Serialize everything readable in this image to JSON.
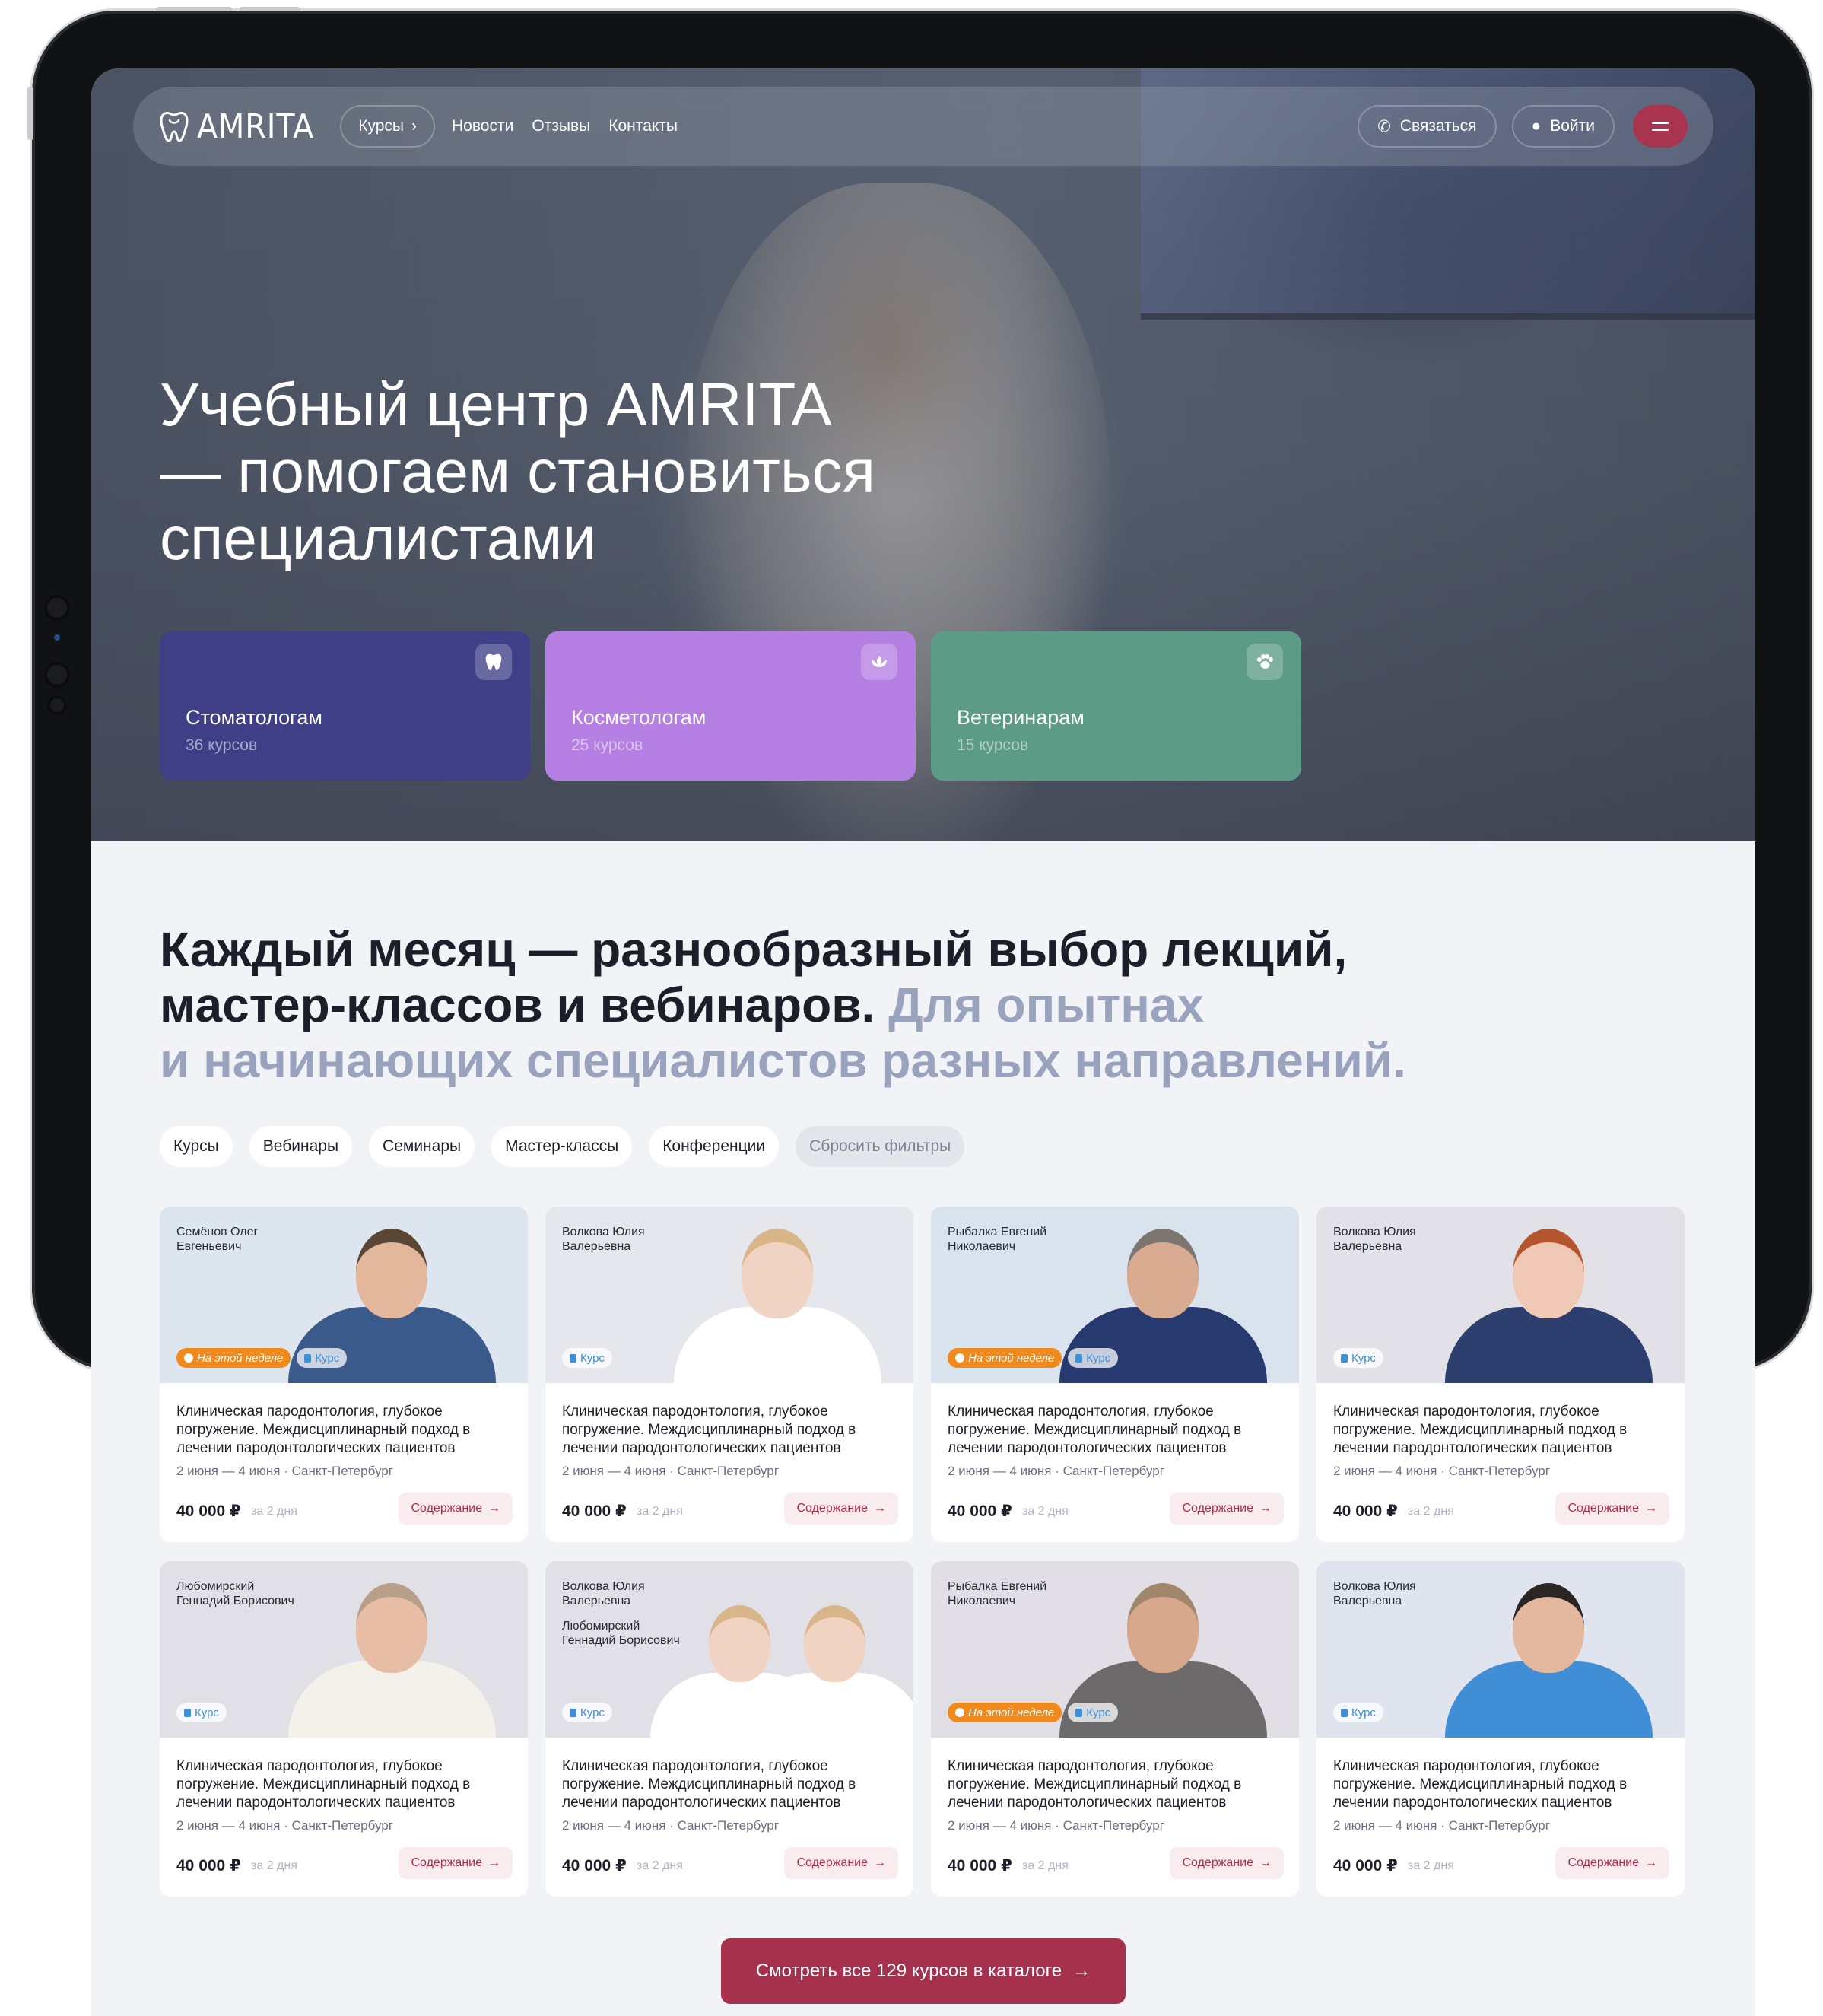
{
  "nav": {
    "logo": "AMRITA",
    "courses": "Курсы",
    "links": [
      "Новости",
      "Отзывы",
      "Контакты"
    ],
    "contact": "Связаться",
    "login": "Войти"
  },
  "hero": {
    "title_line1": "Учебный центр AMRITA",
    "title_line2": "— помогаем становиться",
    "title_line3": "специалистами",
    "categories": [
      {
        "name": "Стоматологам",
        "count": "36 курсов",
        "color": "#3e3f86",
        "icon": "tooth-icon"
      },
      {
        "name": "Косметологам",
        "count": "25 курсов",
        "color": "#b57fe3",
        "icon": "lotus-icon"
      },
      {
        "name": "Ветеринарам",
        "count": "15 курсов",
        "color": "#5c9b86",
        "icon": "paw-icon"
      }
    ]
  },
  "section": {
    "title_dark1": "Каждый месяц — разнообразный выбор лекций,",
    "title_dark2": "мастер-классов и вебинаров.",
    "title_muted1": "Для опытнах",
    "title_muted2": "и начинающих специалистов разных направлений.",
    "filters": [
      "Курсы",
      "Вебинары",
      "Семинары",
      "Мастер-классы",
      "Конференции"
    ],
    "reset": "Сбросить фильтры"
  },
  "course_common": {
    "title": "Клиническая пародонтология, глубокое погружение. Междисциплинарный подход в лечении пародонтологических пациентов",
    "meta": "2 июня — 4 июня · Санкт-Петербург",
    "price": "40 000 ₽",
    "duration": "за 2 дня",
    "more": "Содержание",
    "week_badge": "На этой неделе",
    "kind_badge": "Курс"
  },
  "courses": [
    {
      "author": "Семёнов Олег\nЕвгеньевич",
      "week": true
    },
    {
      "author": "Волкова Юлия\nВалерьевна",
      "week": false
    },
    {
      "author": "Рыбалка Евгений\nНиколаевич",
      "week": true
    },
    {
      "author": "Волкова Юлия\nВалерьевна",
      "week": false
    },
    {
      "author": "Любомирский\nГеннадий Борисович",
      "week": false
    },
    {
      "author": "Волкова Юлия\nВалерьевна",
      "author2": "Любомирский\nГеннадий Борисович",
      "week": false
    },
    {
      "author": "Рыбалка Евгений\nНиколаевич",
      "week": true
    },
    {
      "author": "Волкова Юлия\nВалерьевна",
      "week": false
    }
  ],
  "cta": "Смотреть все 129 курсов в каталоге",
  "colors": {
    "accent": "#a5314d",
    "week_badge": "#f08a1c",
    "kind_badge": "#3f8fd6"
  }
}
